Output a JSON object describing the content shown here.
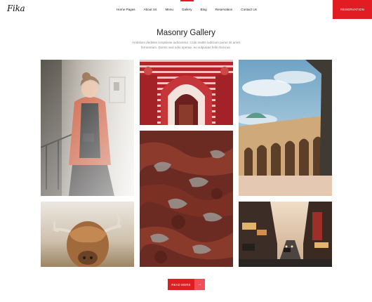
{
  "brand": {
    "logo": "Fika",
    "accent": "#e31b23"
  },
  "nav": {
    "items": [
      {
        "label": "Home Pages"
      },
      {
        "label": "About Us"
      },
      {
        "label": "Menu"
      },
      {
        "label": "Gallery",
        "active": true
      },
      {
        "label": "Blog"
      },
      {
        "label": "Reservation"
      },
      {
        "label": "Contact Us"
      }
    ],
    "cta": "RESERVATION"
  },
  "section": {
    "title": "Masonry Gallery",
    "description_line1": "Ambitioni dedisse scripsisse iudicaretur. Cras mattis iudicium purus sit amet",
    "description_line2": "fermentum. Donec sed odio operae, eu vulputate felis rhoncus."
  },
  "gallery": {
    "items": [
      {
        "name": "woman-photographer-photo"
      },
      {
        "name": "red-white-mosque-photo"
      },
      {
        "name": "domed-mosque-arches-photo"
      },
      {
        "name": "red-rock-texture-photo"
      },
      {
        "name": "highland-cow-photo"
      },
      {
        "name": "city-street-night-photo"
      }
    ]
  },
  "read_more": {
    "label": "READ MORE",
    "arrow": "→"
  }
}
